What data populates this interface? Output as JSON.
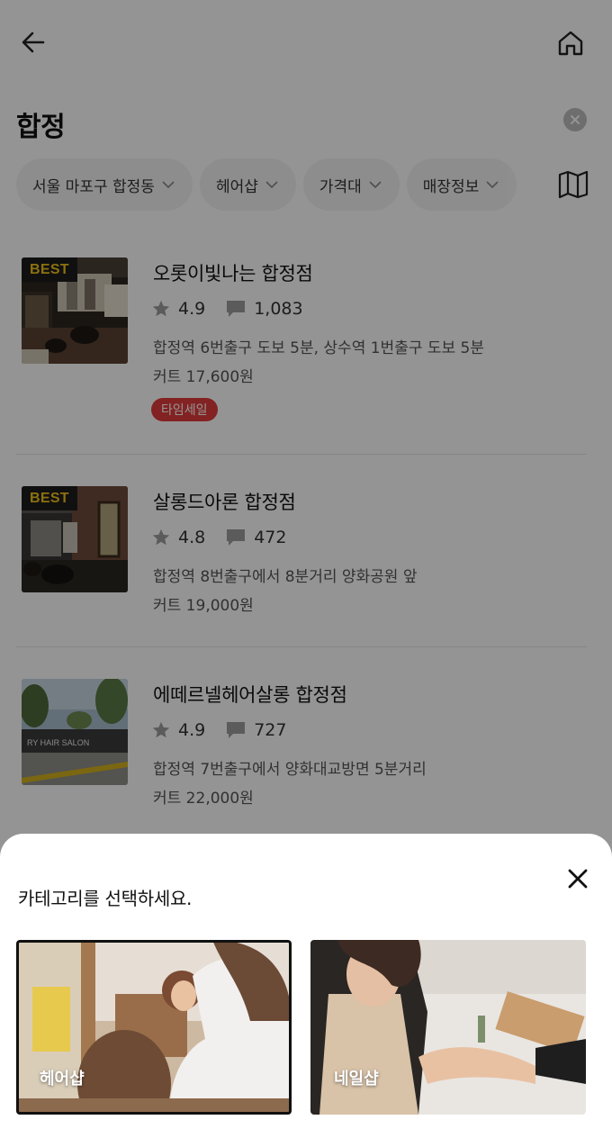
{
  "header": {
    "search_term": "합정"
  },
  "filters": {
    "chips": [
      {
        "label": "서울 마포구 합정동"
      },
      {
        "label": "헤어샵"
      },
      {
        "label": "가격대"
      },
      {
        "label": "매장정보"
      }
    ]
  },
  "shops": [
    {
      "badge": "BEST",
      "name": "오롯이빛나는 합정점",
      "rating": "4.9",
      "reviews": "1,083",
      "address": "합정역 6번출구 도보 5분, 상수역 1번출구 도보 5분",
      "price": "커트 17,600원",
      "tag": "타임세일"
    },
    {
      "badge": "BEST",
      "name": "살롱드아론 합정점",
      "rating": "4.8",
      "reviews": "472",
      "address": "합정역 8번출구에서 8분거리 양화공원 앞",
      "price": "커트 19,000원"
    },
    {
      "name": "에떼르넬헤어살롱 합정점",
      "rating": "4.9",
      "reviews": "727",
      "address": "합정역 7번출구에서 양화대교방면 5분거리",
      "price": "커트 22,000원",
      "photo_sign": "RY HAIR SALON"
    }
  ],
  "sheet": {
    "title": "카테고리를 선택하세요.",
    "categories": [
      {
        "label": "헤어샵",
        "selected": true
      },
      {
        "label": "네일샵",
        "selected": false
      }
    ]
  },
  "colors": {
    "best_badge_text": "#f2c21b",
    "sale_badge_bg": "#e23b3b",
    "dim_overlay": "rgba(0,0,0,0.42)"
  },
  "icons": [
    "back-arrow-icon",
    "home-icon",
    "clear-icon",
    "chevron-down-icon",
    "map-icon",
    "star-icon",
    "comment-icon",
    "close-icon"
  ]
}
